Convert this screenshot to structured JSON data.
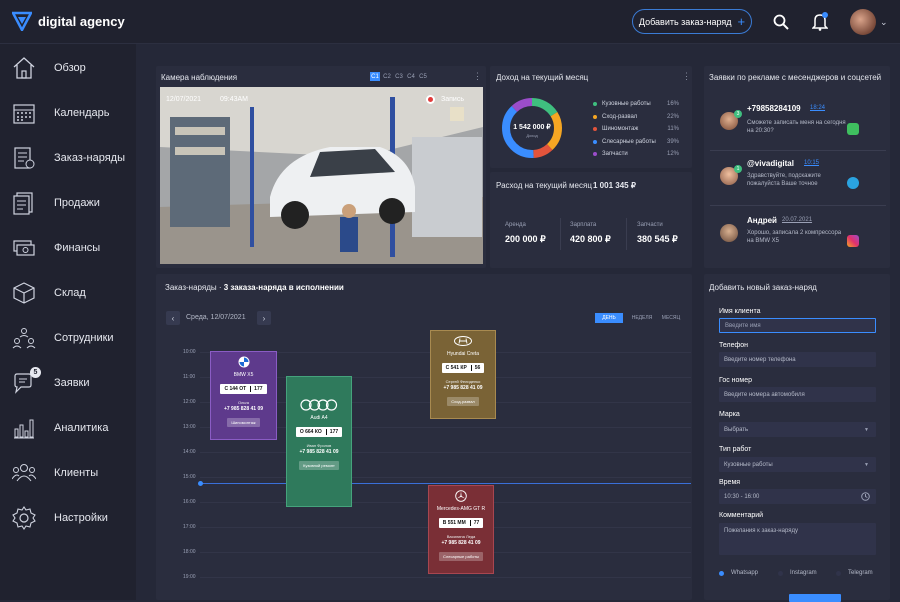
{
  "brand": {
    "name": "digital agency"
  },
  "header": {
    "add_order_label": "Добавить заказ-наряд"
  },
  "sidebar": {
    "items": [
      {
        "label": "Обзор",
        "icon": "home-icon"
      },
      {
        "label": "Календарь",
        "icon": "calendar-icon"
      },
      {
        "label": "Заказ-наряды",
        "icon": "orders-icon"
      },
      {
        "label": "Продажи",
        "icon": "sales-icon"
      },
      {
        "label": "Финансы",
        "icon": "finance-icon"
      },
      {
        "label": "Склад",
        "icon": "warehouse-icon"
      },
      {
        "label": "Сотрудники",
        "icon": "employees-icon"
      },
      {
        "label": "Заявки",
        "icon": "requests-icon",
        "badge": "5"
      },
      {
        "label": "Аналитика",
        "icon": "analytics-icon"
      },
      {
        "label": "Клиенты",
        "icon": "clients-icon"
      },
      {
        "label": "Настройки",
        "icon": "settings-icon"
      }
    ]
  },
  "camera": {
    "title": "Камера наблюдения",
    "tabs": [
      "C1",
      "C2",
      "C3",
      "C4",
      "C5"
    ],
    "active_tab": "C1",
    "date": "12/07/2021",
    "time": "09:43AM",
    "record_label": "Запись"
  },
  "income": {
    "title": "Доход на текущий месяц",
    "total": "1 542 000 ₽",
    "total_label": "Доход",
    "items": [
      {
        "name": "Кузовные работы",
        "pct": "16%",
        "color": "#3fbf7f"
      },
      {
        "name": "Сход-развал",
        "pct": "22%",
        "color": "#f5a623"
      },
      {
        "name": "Шиномонтаж",
        "pct": "11%",
        "color": "#e2543c"
      },
      {
        "name": "Слесарные работы",
        "pct": "39%",
        "color": "#3a8dff"
      },
      {
        "name": "Запчасти",
        "pct": "12%",
        "color": "#9b4dca"
      }
    ],
    "chart_data": {
      "type": "pie",
      "categories": [
        "Кузовные работы",
        "Сход-развал",
        "Шиномонтаж",
        "Слесарные работы",
        "Запчасти"
      ],
      "values": [
        16,
        22,
        11,
        39,
        12
      ]
    }
  },
  "expense": {
    "title": "Расход на текущий месяц",
    "total": "1 001 345 ₽",
    "cols": [
      {
        "label": "Аренда",
        "value": "200 000 ₽"
      },
      {
        "label": "Зарплата",
        "value": "420 800 ₽"
      },
      {
        "label": "Запчасти",
        "value": "380 545 ₽"
      }
    ]
  },
  "messages": {
    "title": "Заявки по рекламе с месенджеров и соцсетей",
    "items": [
      {
        "name": "+79858284109",
        "time": "18:24",
        "text": "Сможете записать меня на сегодня на 20:30?",
        "count": "3",
        "channel": "whatsapp-icon",
        "channel_color": "#3fbf5f"
      },
      {
        "name": "@vivadigital",
        "time": "10:15",
        "text": "Здравствуйте, подскажите пожалуйста Ваше точное",
        "count": "1",
        "channel": "telegram-icon",
        "channel_color": "#2aa3e0"
      },
      {
        "name": "Андрей",
        "time": "20.07.2021",
        "text": "Хорошо, записала 2 компрессора на BMW X5",
        "count": "",
        "channel": "instagram-icon",
        "channel_color": "#e1306c"
      }
    ]
  },
  "schedule": {
    "title": "Заказ-наряды",
    "subtitle": "3 заказа-наряда в исполнении",
    "date": "Среда, 12/07/2021",
    "views": [
      "ДЕНЬ",
      "НЕДЕЛЯ",
      "МЕСЯЦ"
    ],
    "active_view": "ДЕНЬ",
    "hours": [
      "10:00",
      "11:00",
      "12:00",
      "13:00",
      "14:00",
      "15:00",
      "16:00",
      "17:00",
      "18:00",
      "19:00"
    ],
    "orders": [
      {
        "brand": "BMW",
        "model": "BMW X5",
        "plate": "С 144 ОТ",
        "region": "177",
        "client": "Ольга",
        "phone": "+7 985 828 41 09",
        "service": "Шиномонтаж",
        "color": "#5e3a8c"
      },
      {
        "brand": "Audi",
        "model": "Audi A4",
        "plate": "О 664 КО",
        "region": "177",
        "client": "Иван Фролов",
        "phone": "+7 985 828 41 09",
        "service": "Кузовной ремонт",
        "color": "#2f7a5c"
      },
      {
        "brand": "Hyundai",
        "model": "Hyundai Creta",
        "plate": "С 541 КР",
        "region": "56",
        "client": "Сергей Фелиденко",
        "phone": "+7 985 828 41 09",
        "service": "Сход-развал",
        "color": "#7a6336"
      },
      {
        "brand": "Mercedes",
        "model": "Mercedes-AMG GT R",
        "plate": "В 551 ММ",
        "region": "77",
        "client": "Василина Леда",
        "phone": "+7 985 828 41 09",
        "service": "Слесарные работы",
        "color": "#7a2f36"
      }
    ]
  },
  "new_order": {
    "title": "Добавить новый заказ-наряд",
    "fields": [
      {
        "label": "Имя клиента",
        "placeholder": "Введите имя"
      },
      {
        "label": "Телефон",
        "placeholder": "Введите номер телефона"
      },
      {
        "label": "Гос номер",
        "placeholder": "Введите номера автомобиля"
      },
      {
        "label": "Марка",
        "placeholder": "Выбрать"
      },
      {
        "label": "Тип работ",
        "placeholder": "Кузовные работы"
      },
      {
        "label": "Время",
        "placeholder": "10:30 - 16:00"
      },
      {
        "label": "Комментарий",
        "placeholder": "Пожелания к заказ-наряду"
      }
    ],
    "channels": [
      "Whatsapp",
      "Instagram",
      "Telegram"
    ],
    "selected_channel": "Whatsapp"
  }
}
